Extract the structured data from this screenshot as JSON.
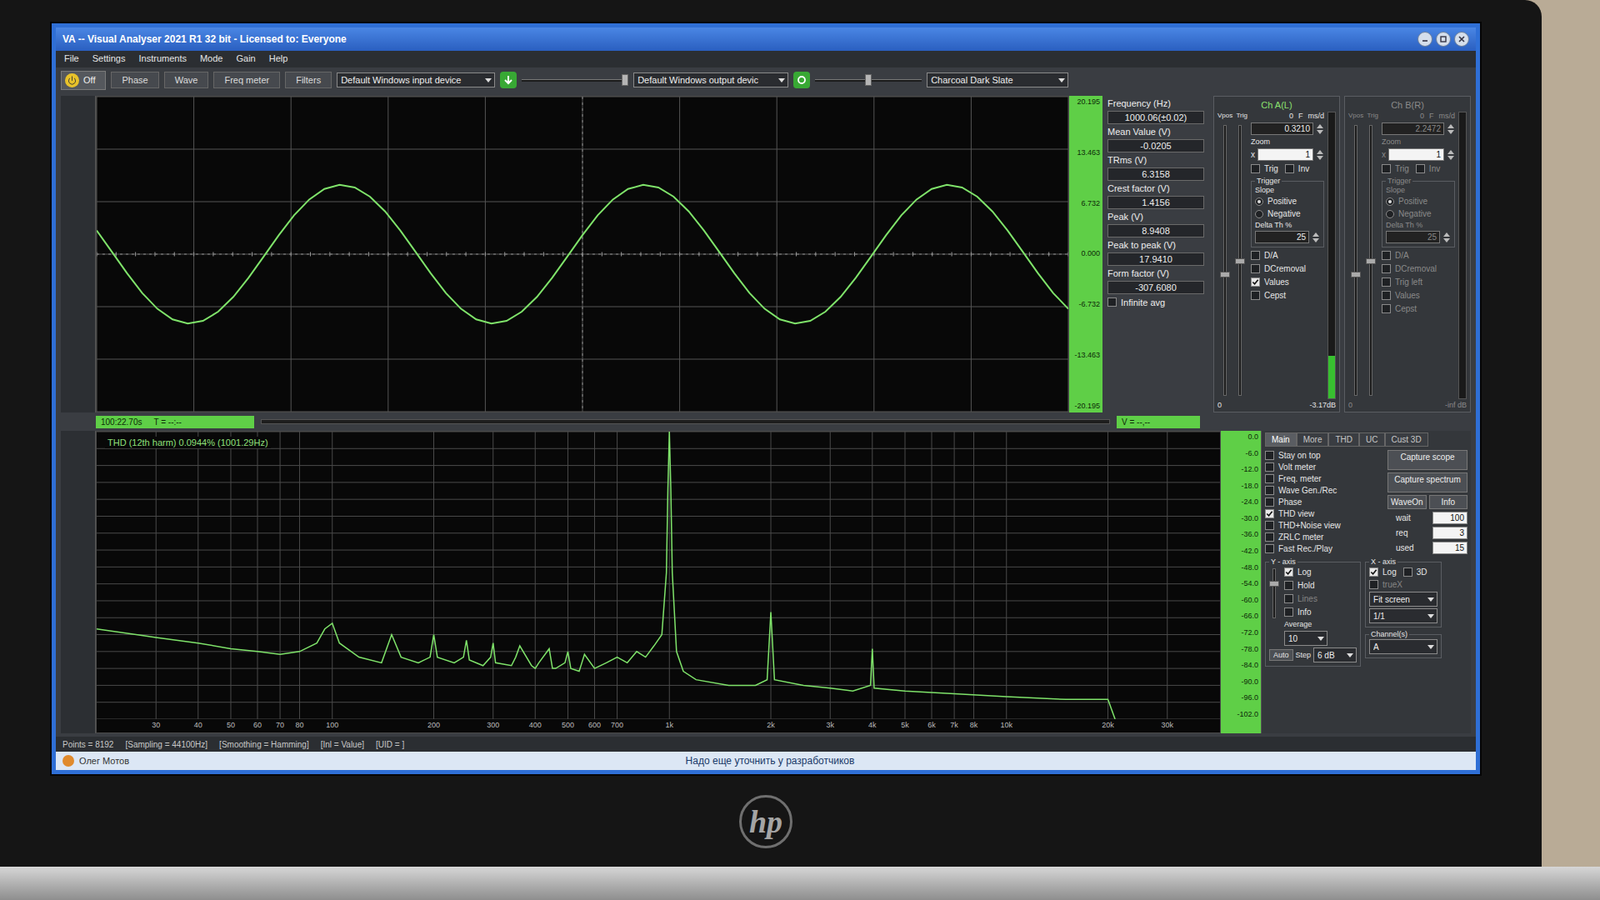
{
  "window": {
    "title": "VA -- Visual Analyser 2021 R1 32 bit - Licensed to: Everyone"
  },
  "menu": [
    "File",
    "Settings",
    "Instruments",
    "Mode",
    "Gain",
    "Help"
  ],
  "toolbar": {
    "power": {
      "label": "Off",
      "on": false
    },
    "tabs": [
      {
        "label": "Phase",
        "selected": false
      },
      {
        "label": "Wave",
        "selected": false
      },
      {
        "label": "Freq meter",
        "selected": false
      },
      {
        "label": "Filters",
        "selected": false
      }
    ],
    "inputDevice": "Default Windows input device",
    "inputLevel": 0.97,
    "outputDevice": "Default Windows output devic",
    "outputLevel": 0.5,
    "theme": "Charcoal Dark Slate"
  },
  "scope": {
    "yTicks": [
      "20.195",
      "13.463",
      "6.732",
      "0.000",
      "-6.732",
      "-13.463",
      "-20.195"
    ],
    "samples": [
      3.04,
      0.31,
      -2.45,
      -4.98,
      -7.01,
      -8.36,
      -8.89,
      -8.56,
      -7.38,
      -5.48,
      -3.04,
      -0.31,
      2.45,
      4.98,
      7.01,
      8.36,
      8.89,
      8.56,
      7.38,
      5.48,
      3.04,
      0.31,
      -2.45,
      -4.98,
      -7.01,
      -8.36,
      -8.89,
      -8.56,
      -7.38,
      -5.48,
      -3.04,
      -0.31,
      2.45,
      4.98,
      7.01,
      8.36,
      8.89,
      8.56,
      7.38,
      5.48,
      3.04,
      0.31,
      -2.45,
      -4.98,
      -7.01,
      -8.36,
      -8.89,
      -8.56,
      -7.38,
      -5.48,
      -3.04,
      -0.31,
      2.45,
      4.98,
      7.01,
      8.36,
      8.89,
      8.56,
      7.38,
      5.48,
      3.04,
      0.31,
      -2.45,
      -4.98,
      -7.01
    ],
    "cursor": {
      "time": "100:22.70s",
      "t": "T = --:--",
      "v": "V = --,--"
    }
  },
  "readings": [
    {
      "label": "Frequency (Hz)",
      "value": "1000.06(±0.02)"
    },
    {
      "label": "Mean Value (V)",
      "value": "-0.0205"
    },
    {
      "label": "TRms (V)",
      "value": "6.3158"
    },
    {
      "label": "Crest factor (V)",
      "value": "1.4156"
    },
    {
      "label": "Peak (V)",
      "value": "8.9408"
    },
    {
      "label": "Peak to peak (V)",
      "value": "17.9410"
    },
    {
      "label": "Form factor (V)",
      "value": "-307.6080"
    }
  ],
  "infiniteAvg": {
    "label": "Infinite avg",
    "checked": false
  },
  "channels": [
    {
      "title": "Ch A(L)",
      "enabled": true,
      "vposLabel": "Vpos",
      "trigLabel": "Trig",
      "spin": [
        "0",
        "F",
        "ms/d"
      ],
      "value": "0.3210",
      "zoomLabel": "Zoom",
      "zoomX": "x",
      "zoom": "1",
      "checks": [
        {
          "label": "Trig",
          "checked": false
        },
        {
          "label": "Inv",
          "checked": false
        }
      ],
      "triggerTitle": "Trigger",
      "slopeTitle": "Slope",
      "slopes": [
        {
          "label": "Positive",
          "selected": true
        },
        {
          "label": "Negative",
          "selected": false
        }
      ],
      "deltaLabel": "Delta Th %",
      "delta": "25",
      "options": [
        {
          "label": "D/A",
          "checked": false
        },
        {
          "label": "DCremoval",
          "checked": false
        },
        {
          "label": "Values",
          "checked": true
        },
        {
          "label": "Cepst",
          "checked": false
        }
      ],
      "bottomLeft": "0",
      "bottomRight": "-3.17dB",
      "meter": 0.15,
      "vposLevel": 0.45,
      "trigLevel": 0.5
    },
    {
      "title": "Ch B(R)",
      "enabled": false,
      "vposLabel": "Vpos",
      "trigLabel": "Trig",
      "spin": [
        "0",
        "F",
        "ms/d"
      ],
      "value": "2.2472",
      "zoomLabel": "Zoom",
      "zoomX": "x",
      "zoom": "1",
      "checks": [
        {
          "label": "Trig",
          "checked": false
        },
        {
          "label": "Inv",
          "checked": false
        }
      ],
      "triggerTitle": "Trigger",
      "slopeTitle": "Slope",
      "slopes": [
        {
          "label": "Positive",
          "selected": true
        },
        {
          "label": "Negative",
          "selected": false
        }
      ],
      "deltaLabel": "Delta Th %",
      "delta": "25",
      "options": [
        {
          "label": "D/A",
          "checked": false
        },
        {
          "label": "DCremoval",
          "checked": false
        },
        {
          "label": "Trig left",
          "checked": false
        },
        {
          "label": "Values",
          "checked": false
        },
        {
          "label": "Cepst",
          "checked": false
        }
      ],
      "bottomLeft": "0",
      "bottomRight": "-inf dB",
      "meter": 0,
      "vposLevel": 0.45,
      "trigLevel": 0.5
    }
  ],
  "spectrum": {
    "label": "THD (12th harm) 0.0944% (1001.29Hz)",
    "xMin": 20,
    "xMax": 43000,
    "xTicks": [
      {
        "label": "30",
        "freq": 30
      },
      {
        "label": "40",
        "freq": 40
      },
      {
        "label": "50",
        "freq": 50
      },
      {
        "label": "60",
        "freq": 60
      },
      {
        "label": "70",
        "freq": 70
      },
      {
        "label": "80",
        "freq": 80
      },
      {
        "label": "100",
        "freq": 100
      },
      {
        "label": "200",
        "freq": 200
      },
      {
        "label": "300",
        "freq": 300
      },
      {
        "label": "400",
        "freq": 400
      },
      {
        "label": "500",
        "freq": 500
      },
      {
        "label": "600",
        "freq": 600
      },
      {
        "label": "700",
        "freq": 700
      },
      {
        "label": "1k",
        "freq": 1000
      },
      {
        "label": "2k",
        "freq": 2000
      },
      {
        "label": "3k",
        "freq": 3000
      },
      {
        "label": "4k",
        "freq": 4000
      },
      {
        "label": "5k",
        "freq": 5000
      },
      {
        "label": "6k",
        "freq": 6000
      },
      {
        "label": "7k",
        "freq": 7000
      },
      {
        "label": "8k",
        "freq": 8000
      },
      {
        "label": "10k",
        "freq": 10000
      },
      {
        "label": "20k",
        "freq": 20000
      },
      {
        "label": "30k",
        "freq": 30000
      }
    ],
    "yTicks": [
      "0.0",
      "-6.0",
      "-12.0",
      "-18.0",
      "-24.0",
      "-30.0",
      "-36.0",
      "-42.0",
      "-48.0",
      "-54.0",
      "-60.0",
      "-66.0",
      "-72.0",
      "-78.0",
      "-84.0",
      "-90.0",
      "-96.0",
      "-102.0"
    ],
    "freqs": [
      20,
      30,
      40,
      50,
      60,
      70,
      80,
      90,
      95,
      100,
      105,
      120,
      140,
      150,
      160,
      180,
      195,
      200,
      205,
      230,
      245,
      250,
      255,
      280,
      295,
      300,
      305,
      340,
      350,
      360,
      390,
      400,
      410,
      440,
      450,
      460,
      490,
      500,
      510,
      540,
      550,
      560,
      600,
      650,
      700,
      750,
      800,
      850,
      900,
      950,
      980,
      990,
      1000,
      1010,
      1020,
      1050,
      1100,
      1200,
      1500,
      1800,
      1950,
      2000,
      2050,
      2500,
      3000,
      3500,
      3950,
      4000,
      4050,
      5000,
      7000,
      10000,
      15000,
      20000,
      21000
    ],
    "levels": [
      -70,
      -73,
      -75,
      -77,
      -78,
      -79,
      -78,
      -75,
      -70,
      -68,
      -75,
      -80,
      -82,
      -72,
      -80,
      -82,
      -80,
      -72,
      -80,
      -82,
      -80,
      -74,
      -81,
      -83,
      -80,
      -75,
      -82,
      -83,
      -80,
      -76,
      -83,
      -84,
      -82,
      -77,
      -84,
      -84,
      -82,
      -78,
      -84,
      -85,
      -82,
      -79,
      -84,
      -82,
      -80,
      -82,
      -78,
      -80,
      -76,
      -72,
      -50,
      -20,
      0,
      -20,
      -50,
      -78,
      -85,
      -88,
      -90,
      -90,
      -88,
      -64,
      -88,
      -90,
      -91,
      -92,
      -90,
      -77,
      -91,
      -92,
      -93,
      -94,
      -95,
      -95,
      -102
    ]
  },
  "sidePanel": {
    "tabs": [
      {
        "label": "Main",
        "selected": true
      },
      {
        "label": "More",
        "selected": false
      },
      {
        "label": "THD",
        "selected": false
      },
      {
        "label": "UC",
        "selected": false
      },
      {
        "label": "Cust 3D",
        "selected": false
      }
    ],
    "checks": [
      {
        "label": "Stay on top",
        "checked": false
      },
      {
        "label": "Volt meter",
        "checked": false
      },
      {
        "label": "Freq. meter",
        "checked": false
      },
      {
        "label": "Wave Gen./Rec",
        "checked": false
      },
      {
        "label": "Phase",
        "checked": false
      },
      {
        "label": "THD view",
        "checked": true
      },
      {
        "label": "THD+Noise view",
        "checked": false
      },
      {
        "label": "ZRLC meter",
        "checked": false
      },
      {
        "label": "Fast Rec./Play",
        "checked": false
      }
    ],
    "wideButtons": [
      "Capture scope",
      "Capture spectrum"
    ],
    "smallButtons": [
      "WaveOn",
      "Info"
    ],
    "fields": [
      {
        "label": "wait",
        "value": "100"
      },
      {
        "label": "req",
        "value": "3"
      },
      {
        "label": "used",
        "value": "15"
      }
    ],
    "yAxis": {
      "title": "Y - axis",
      "checks": [
        {
          "label": "Log",
          "checked": true,
          "disabled": false
        },
        {
          "label": "Hold",
          "checked": false,
          "disabled": false
        },
        {
          "label": "Lines",
          "checked": false,
          "disabled": true
        },
        {
          "label": "Info",
          "checked": false,
          "disabled": false
        }
      ],
      "averageLabel": "Average",
      "average": "10",
      "stepLabel": "Step",
      "step": "6 dB",
      "auto": "Auto",
      "level": 0.7
    },
    "xAxis": {
      "title": "X - axis",
      "checks": [
        {
          "label": "Log",
          "checked": true,
          "disabled": false
        },
        {
          "label": "3D",
          "checked": false,
          "disabled": false
        },
        {
          "label": "trueX",
          "checked": false,
          "disabled": true
        }
      ],
      "fit": "Fit screen",
      "ratio": "1/1"
    },
    "channelSel": {
      "title": "Channel(s)",
      "value": "A"
    }
  },
  "status": [
    "Points = 8192",
    "[Sampling = 44100Hz]",
    "[Smoothing = Hamming]",
    "[Inl = Value]",
    "[UID = ]"
  ],
  "overlay": {
    "author": "Олег Мотов",
    "message": "Надо еще уточнить у разработчиков"
  },
  "brand": "hp"
}
